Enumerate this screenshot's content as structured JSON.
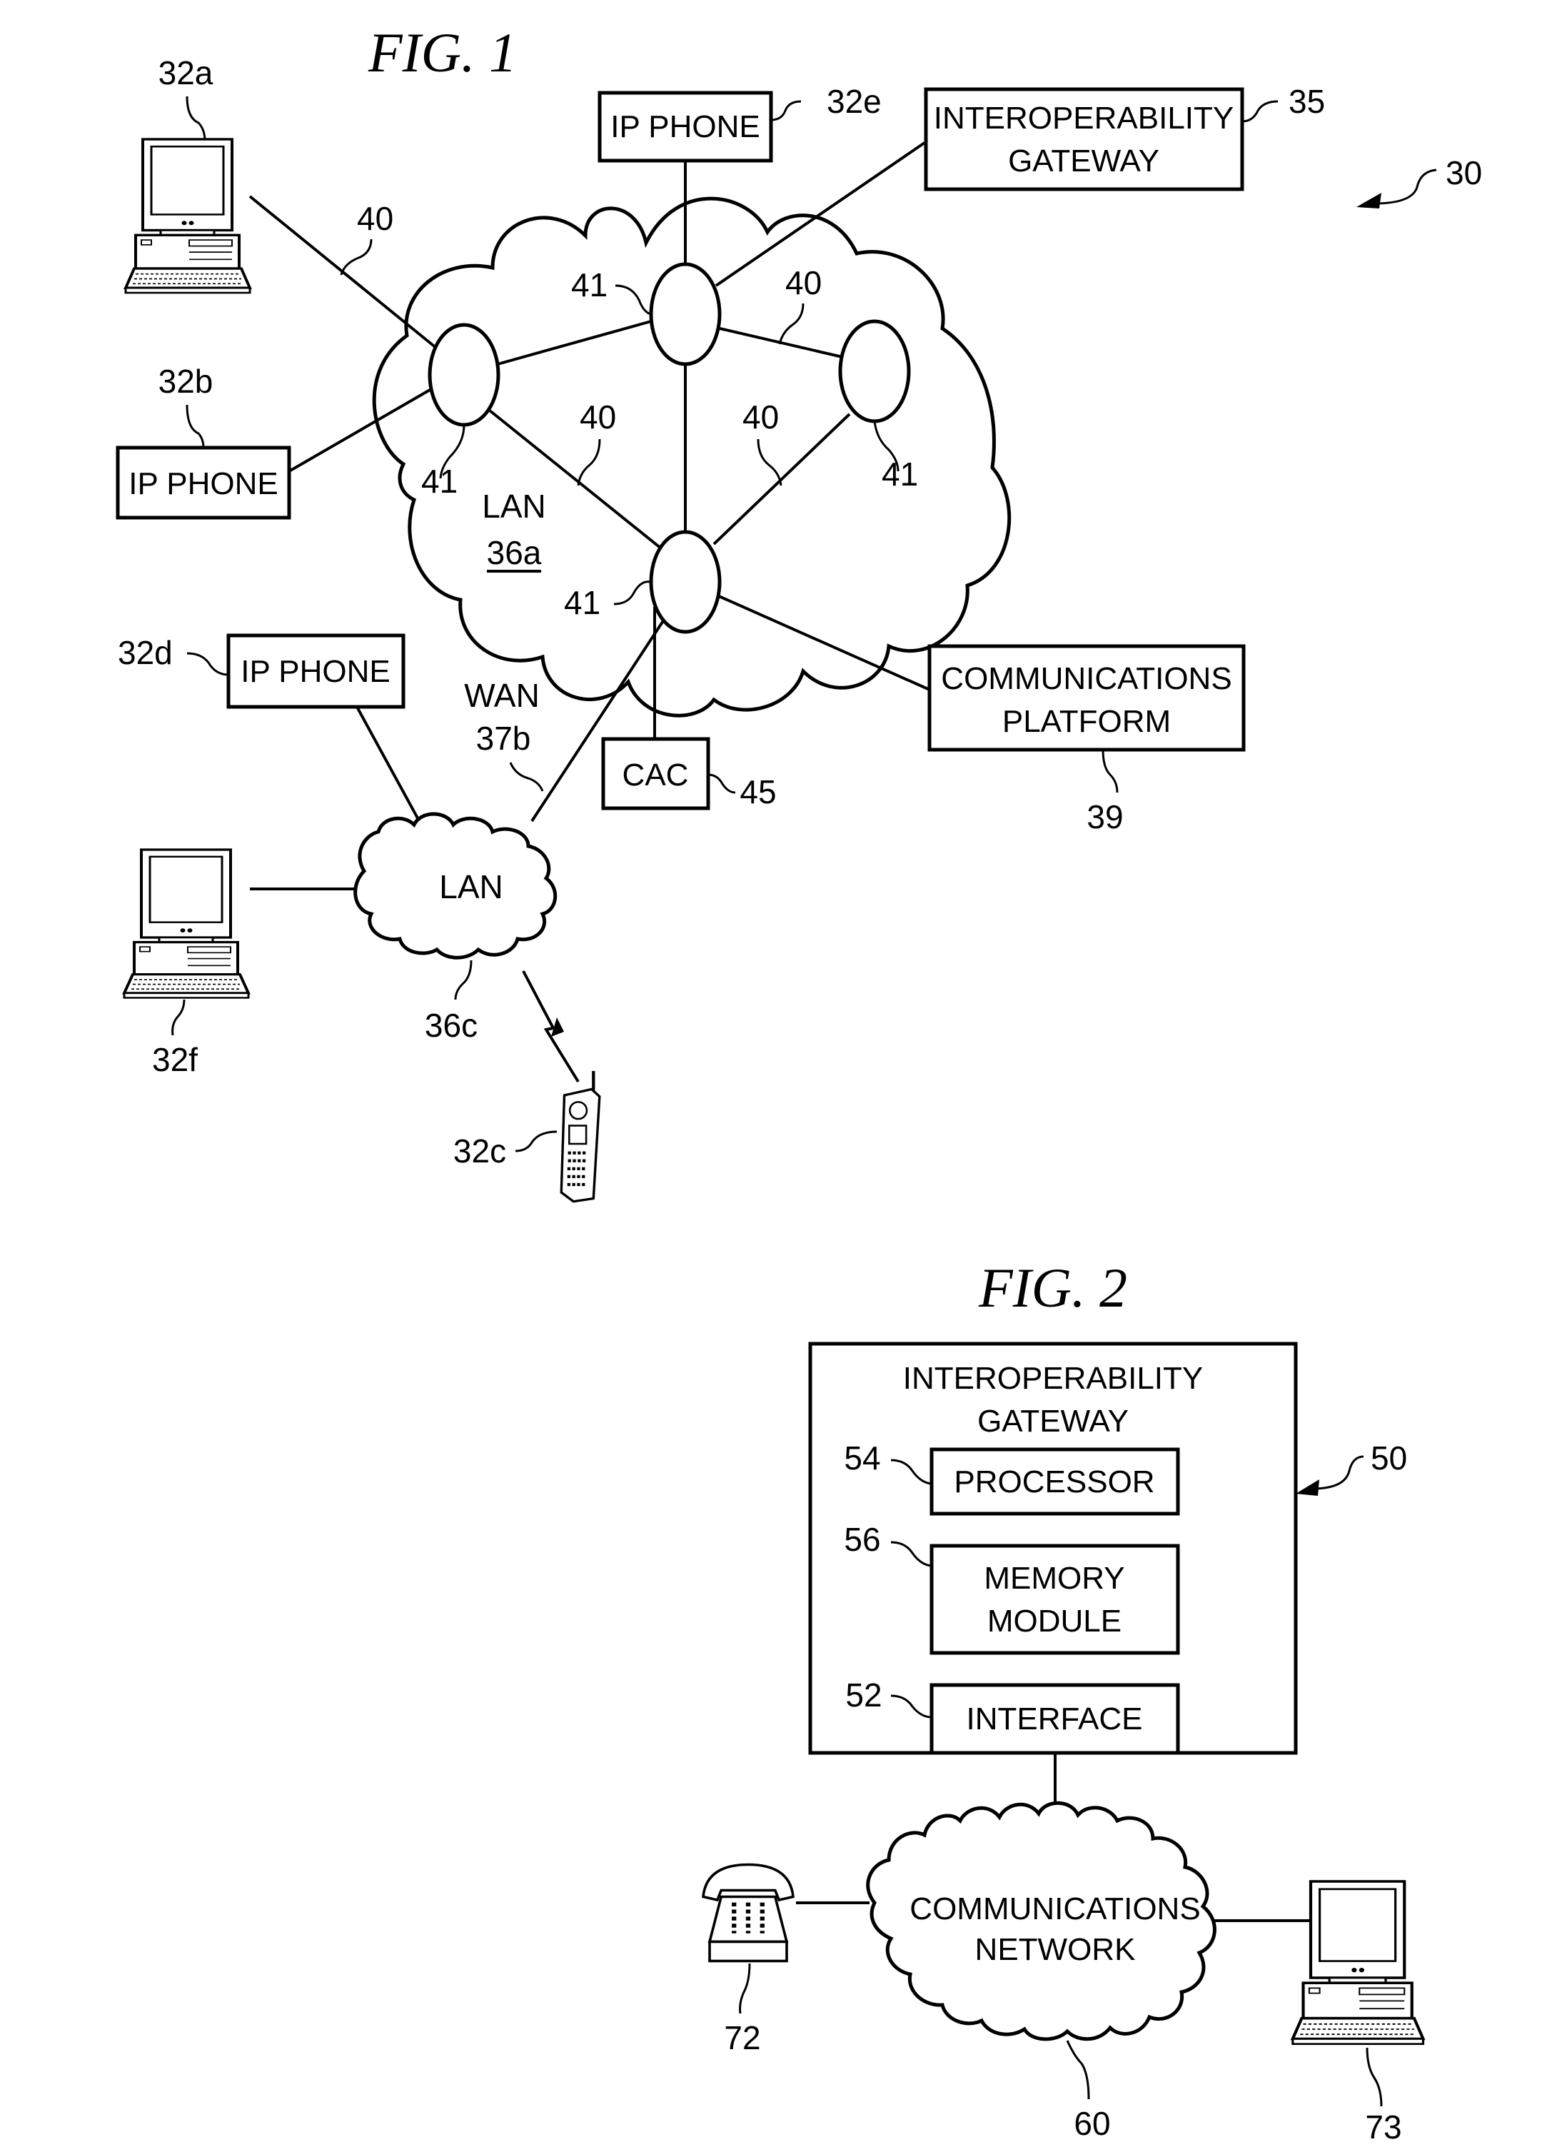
{
  "figure1": {
    "title": "FIG. 1",
    "system_ref": "30",
    "devices": {
      "computer_a": {
        "ref": "32a"
      },
      "ip_phone_b": {
        "label": "IP PHONE",
        "ref": "32b"
      },
      "cell_phone_c": {
        "ref": "32c"
      },
      "ip_phone_d": {
        "label": "IP PHONE",
        "ref": "32d"
      },
      "ip_phone_e": {
        "label": "IP PHONE",
        "ref": "32e"
      },
      "computer_f": {
        "ref": "32f"
      }
    },
    "gateway": {
      "label_line1": "INTEROPERABILITY",
      "label_line2": "GATEWAY",
      "ref": "35"
    },
    "platform": {
      "label_line1": "COMMUNICATIONS",
      "label_line2": "PLATFORM",
      "ref": "39"
    },
    "cac": {
      "label": "CAC",
      "ref": "45"
    },
    "lan_a": {
      "label": "LAN",
      "ref": "36a"
    },
    "lan_c": {
      "label": "LAN",
      "ref": "36c"
    },
    "wan": {
      "label": "WAN",
      "ref": "37b"
    },
    "node_ref": "41",
    "link_ref": "40"
  },
  "figure2": {
    "title": "FIG. 2",
    "gateway": {
      "label_line1": "INTEROPERABILITY",
      "label_line2": "GATEWAY",
      "ref": "50"
    },
    "processor": {
      "label": "PROCESSOR",
      "ref": "54"
    },
    "memory": {
      "label_line1": "MEMORY",
      "label_line2": "MODULE",
      "ref": "56"
    },
    "interface": {
      "label": "INTERFACE",
      "ref": "52"
    },
    "network": {
      "label_line1": "COMMUNICATIONS",
      "label_line2": "NETWORK",
      "ref": "60"
    },
    "telephone": {
      "ref": "72"
    },
    "computer": {
      "ref": "73"
    }
  }
}
